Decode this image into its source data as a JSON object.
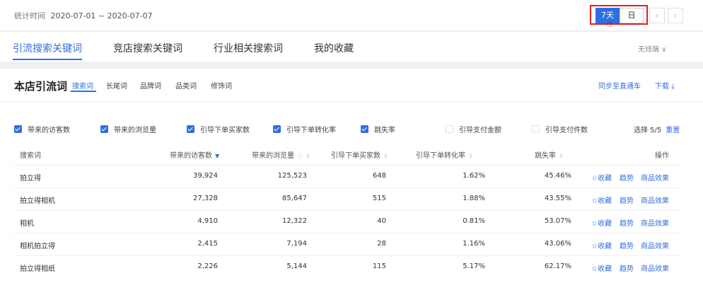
{
  "date_range": {
    "label": "统计时间",
    "value": "2020-07-01 ~ 2020-07-07"
  },
  "period_buttons": {
    "week": "7天",
    "day": "日"
  },
  "nav_prev": "‹",
  "nav_next": "›",
  "tabs": [
    "引流搜索关键词",
    "竞店搜索关键词",
    "行业相关搜索词",
    "我的收藏"
  ],
  "device_select": "无线端 ∨",
  "card": {
    "title": "本店引流词",
    "subtabs": [
      "搜索词",
      "长尾词",
      "品牌词",
      "品类词",
      "修饰词"
    ],
    "sync_label": "同步至直通车",
    "download_label": "下载 ⤓"
  },
  "metrics": [
    {
      "label": "带来的访客数",
      "checked": true
    },
    {
      "label": "带来的浏览量",
      "checked": true
    },
    {
      "label": "引导下单买家数",
      "checked": true
    },
    {
      "label": "引导下单转化率",
      "checked": true
    },
    {
      "label": "跳失率",
      "checked": true
    },
    {
      "label": "引导支付金额",
      "checked": false
    },
    {
      "label": "引导支付件数",
      "checked": false
    }
  ],
  "select_count": "选择 5/5",
  "reset_label": "重置",
  "columns": [
    "搜索词",
    "带来的访客数",
    "带来的浏览量",
    "引导下单买家数",
    "引导下单转化率",
    "跳失率",
    "操作"
  ],
  "rows": [
    {
      "keyword": "拍立得",
      "visitors": "39,924",
      "pageviews": "125,523",
      "buyers": "648",
      "conversion": "1.62%",
      "bounce": "45.46%"
    },
    {
      "keyword": "拍立得相机",
      "visitors": "27,328",
      "pageviews": "85,647",
      "buyers": "515",
      "conversion": "1.88%",
      "bounce": "43.55%"
    },
    {
      "keyword": "相机",
      "visitors": "4,910",
      "pageviews": "12,322",
      "buyers": "40",
      "conversion": "0.81%",
      "bounce": "53.07%"
    },
    {
      "keyword": "相机拍立得",
      "visitors": "2,415",
      "pageviews": "7,194",
      "buyers": "28",
      "conversion": "1.16%",
      "bounce": "43.06%"
    },
    {
      "keyword": "拍立得相纸",
      "visitors": "2,226",
      "pageviews": "5,144",
      "buyers": "115",
      "conversion": "5.17%",
      "bounce": "62.17%"
    }
  ],
  "row_actions": {
    "collect": "☆收藏",
    "trend": "趋势",
    "product": "商品效果"
  },
  "colors": {
    "accent": "#2f6fe0",
    "highlight": "#e02020"
  }
}
